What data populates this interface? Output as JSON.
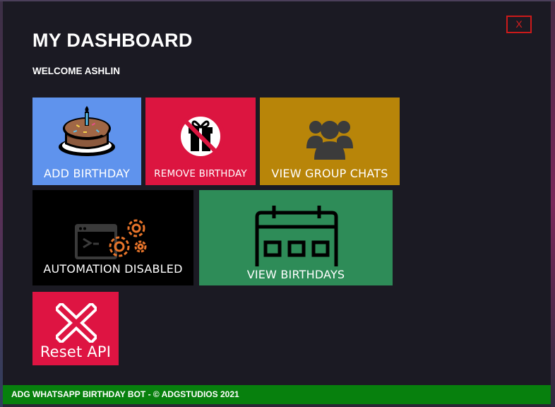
{
  "window": {
    "title": "MY DASHBOARD",
    "welcome": "WELCOME ASHLIN",
    "close_label": "X"
  },
  "tiles": {
    "add_birthday": {
      "label": "ADD BIRTHDAY",
      "color": "#5f93ed",
      "icon": "birthday-cake-icon"
    },
    "remove_birthday": {
      "label": "REMOVE BIRTHDAY",
      "color": "#dc1540",
      "icon": "no-gift-icon"
    },
    "view_group_chats": {
      "label": "VIEW GROUP CHATS",
      "color": "#b88509",
      "icon": "group-icon"
    },
    "automation": {
      "label": "AUTOMATION DISABLED",
      "color": "#000000",
      "icon": "terminal-gears-icon"
    },
    "view_birthdays": {
      "label": "VIEW BIRTHDAYS",
      "color": "#2e8c58",
      "icon": "calendar-icon"
    },
    "reset_api": {
      "label": "Reset API",
      "color": "#de1442",
      "icon": "x-icon"
    }
  },
  "footer": {
    "text": "ADG WHATSAPP BIRTHDAY BOT - © ADGSTUDIOS 2021",
    "color": "#07800d"
  }
}
